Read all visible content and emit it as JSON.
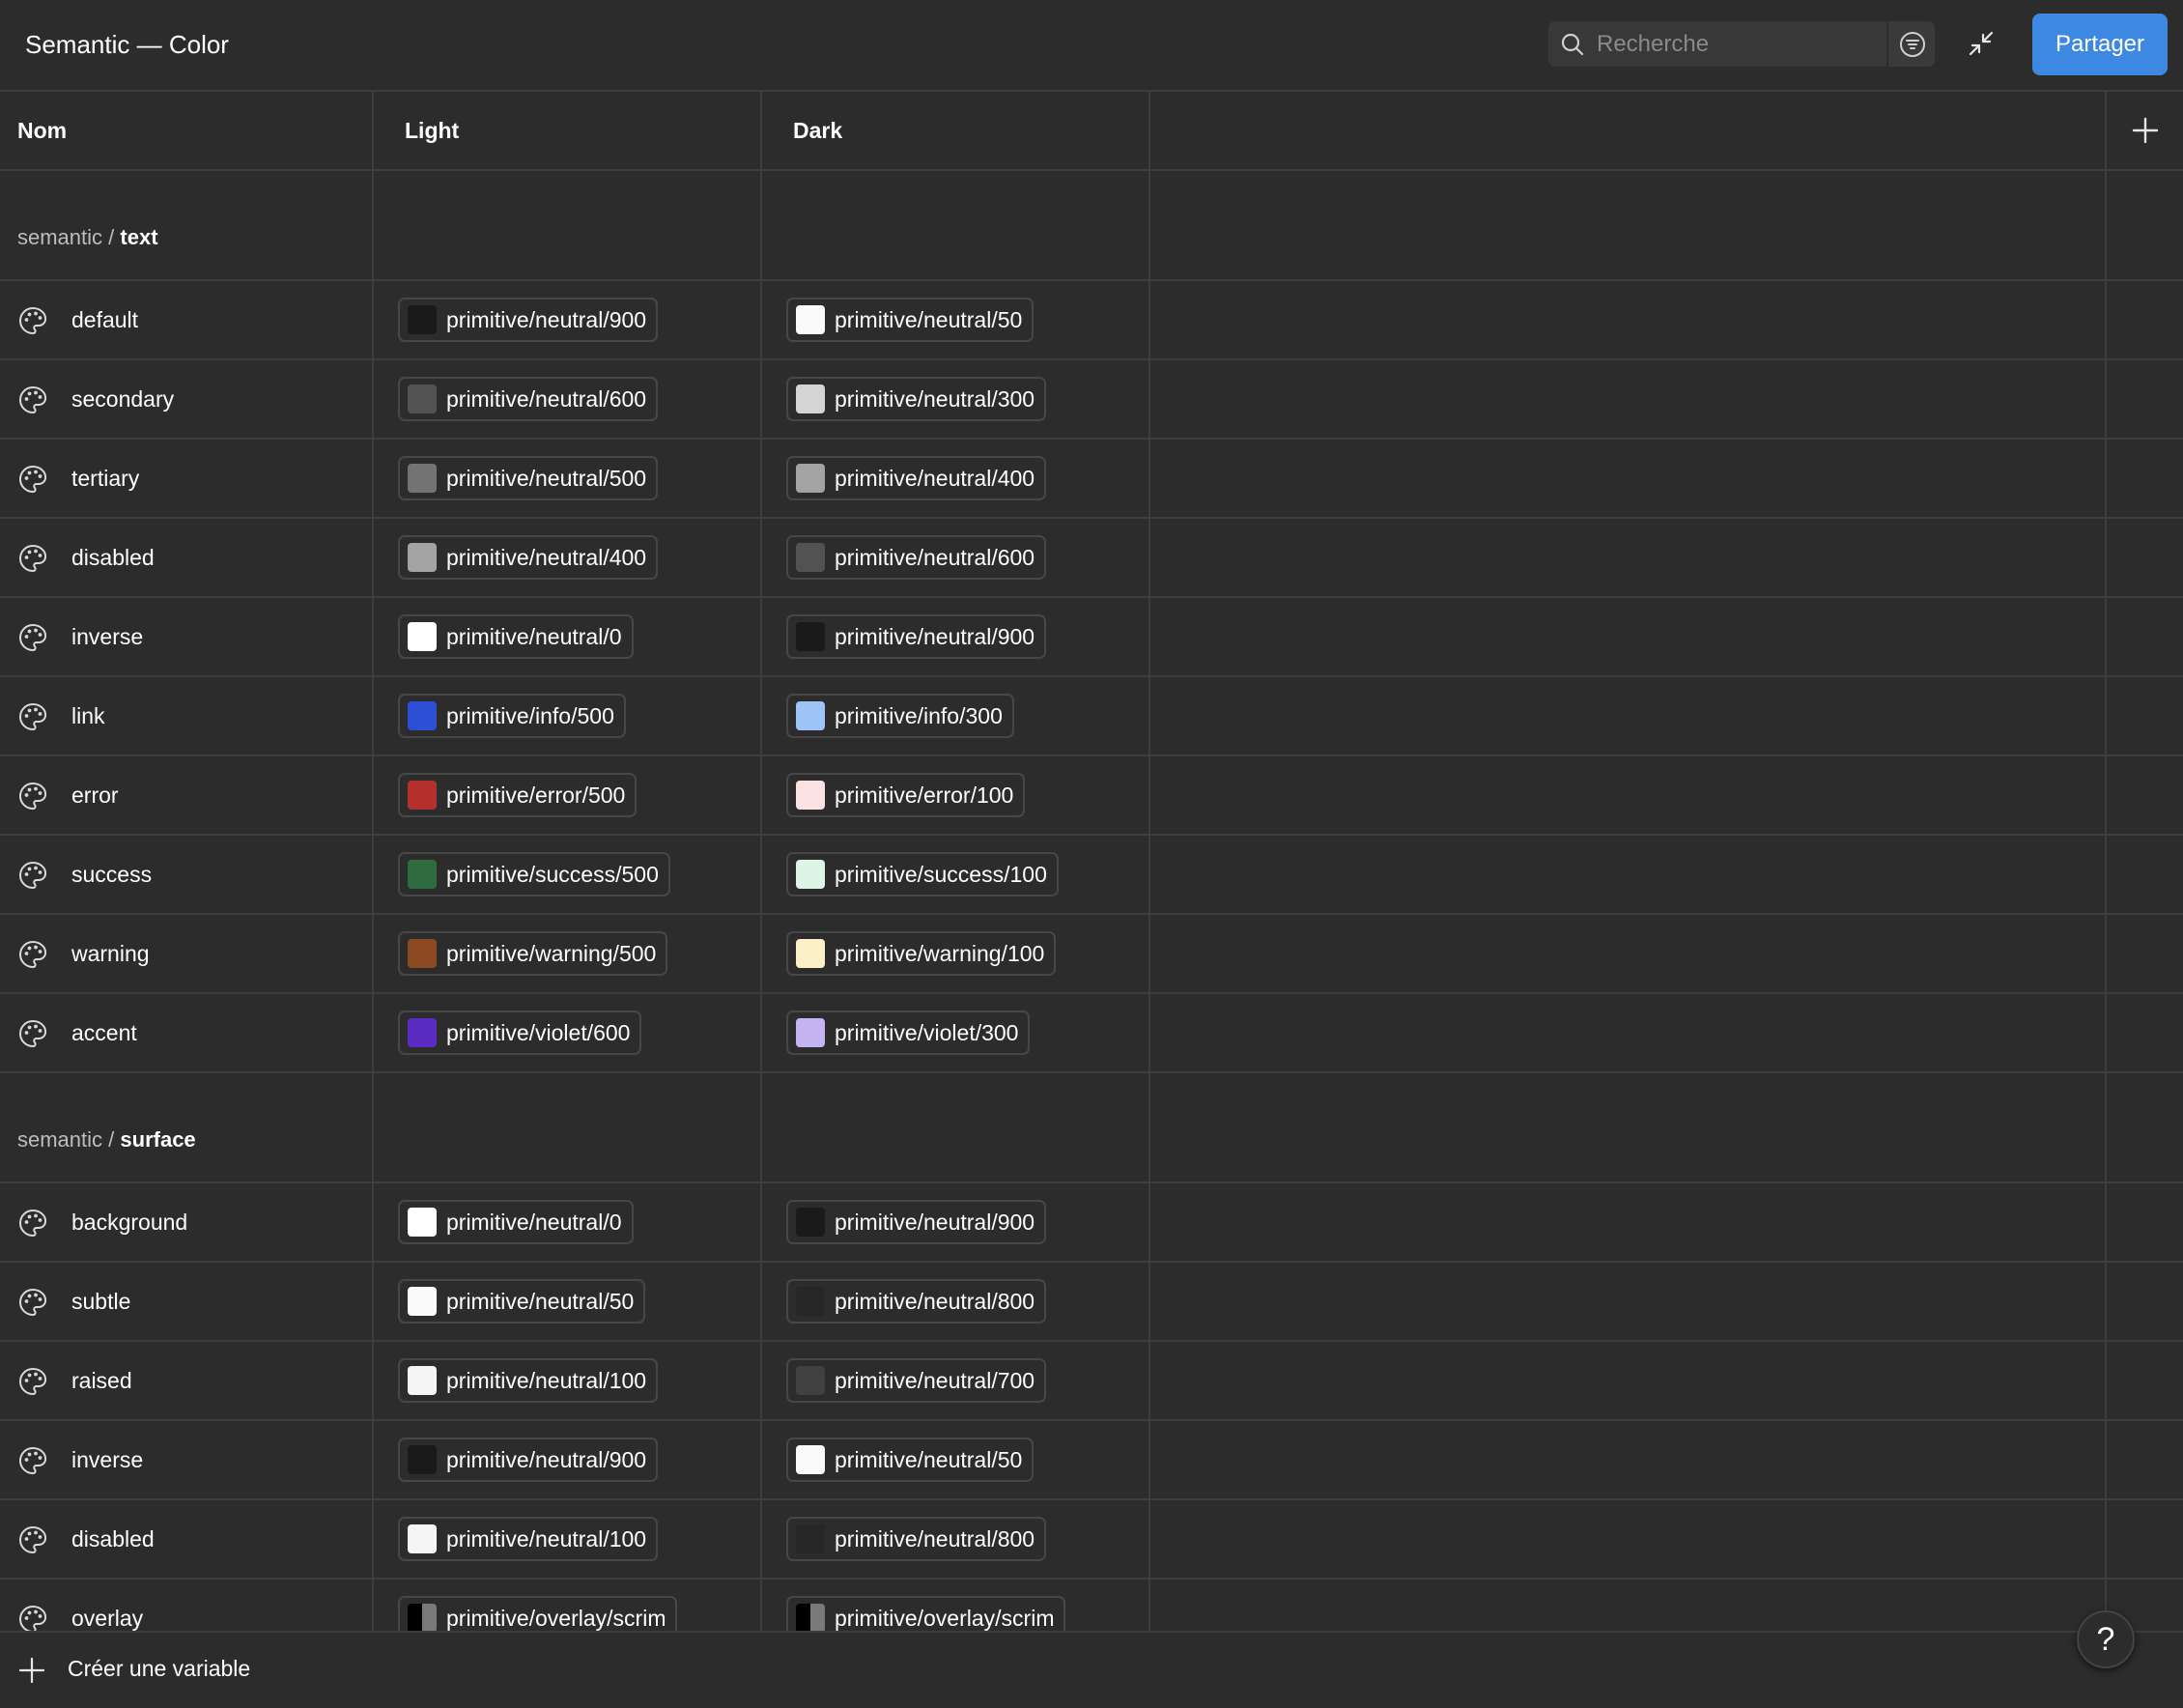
{
  "header": {
    "title": "Semantic — Color",
    "search_placeholder": "Recherche",
    "share_label": "Partager"
  },
  "columns": {
    "name": "Nom",
    "light": "Light",
    "dark": "Dark"
  },
  "groups": [
    {
      "prefix": "semantic /",
      "name": "text",
      "rows": [
        {
          "name": "default",
          "light": {
            "label": "primitive/neutral/900",
            "color": "#1a1a1a"
          },
          "dark": {
            "label": "primitive/neutral/50",
            "color": "#fafafa"
          }
        },
        {
          "name": "secondary",
          "light": {
            "label": "primitive/neutral/600",
            "color": "#525252"
          },
          "dark": {
            "label": "primitive/neutral/300",
            "color": "#d4d4d4"
          }
        },
        {
          "name": "tertiary",
          "light": {
            "label": "primitive/neutral/500",
            "color": "#737373"
          },
          "dark": {
            "label": "primitive/neutral/400",
            "color": "#a3a3a3"
          }
        },
        {
          "name": "disabled",
          "light": {
            "label": "primitive/neutral/400",
            "color": "#a3a3a3"
          },
          "dark": {
            "label": "primitive/neutral/600",
            "color": "#525252"
          }
        },
        {
          "name": "inverse",
          "light": {
            "label": "primitive/neutral/0",
            "color": "#ffffff"
          },
          "dark": {
            "label": "primitive/neutral/900",
            "color": "#1a1a1a"
          }
        },
        {
          "name": "link",
          "light": {
            "label": "primitive/info/500",
            "color": "#2d4fd6"
          },
          "dark": {
            "label": "primitive/info/300",
            "color": "#9ec3f7"
          }
        },
        {
          "name": "error",
          "light": {
            "label": "primitive/error/500",
            "color": "#b3302c"
          },
          "dark": {
            "label": "primitive/error/100",
            "color": "#fbe1e1"
          }
        },
        {
          "name": "success",
          "light": {
            "label": "primitive/success/500",
            "color": "#2e6b3f"
          },
          "dark": {
            "label": "primitive/success/100",
            "color": "#dcf5e6"
          }
        },
        {
          "name": "warning",
          "light": {
            "label": "primitive/warning/500",
            "color": "#8c4a22"
          },
          "dark": {
            "label": "primitive/warning/100",
            "color": "#fcf0c8"
          }
        },
        {
          "name": "accent",
          "light": {
            "label": "primitive/violet/600",
            "color": "#5b2cc4"
          },
          "dark": {
            "label": "primitive/violet/300",
            "color": "#c5b4f2"
          }
        }
      ]
    },
    {
      "prefix": "semantic /",
      "name": "surface",
      "rows": [
        {
          "name": "background",
          "light": {
            "label": "primitive/neutral/0",
            "color": "#ffffff"
          },
          "dark": {
            "label": "primitive/neutral/900",
            "color": "#1a1a1a"
          }
        },
        {
          "name": "subtle",
          "light": {
            "label": "primitive/neutral/50",
            "color": "#fafafa"
          },
          "dark": {
            "label": "primitive/neutral/800",
            "color": "#262626"
          }
        },
        {
          "name": "raised",
          "light": {
            "label": "primitive/neutral/100",
            "color": "#f5f5f5"
          },
          "dark": {
            "label": "primitive/neutral/700",
            "color": "#404040"
          }
        },
        {
          "name": "inverse",
          "light": {
            "label": "primitive/neutral/900",
            "color": "#1a1a1a"
          },
          "dark": {
            "label": "primitive/neutral/50",
            "color": "#fafafa"
          }
        },
        {
          "name": "disabled",
          "light": {
            "label": "primitive/neutral/100",
            "color": "#f5f5f5"
          },
          "dark": {
            "label": "primitive/neutral/800",
            "color": "#262626"
          }
        },
        {
          "name": "overlay",
          "light": {
            "label": "primitive/overlay/scrim",
            "color": "scrim"
          },
          "dark": {
            "label": "primitive/overlay/scrim",
            "color": "scrim"
          }
        }
      ]
    }
  ],
  "footer": {
    "create_label": "Créer une variable",
    "help_label": "?"
  }
}
